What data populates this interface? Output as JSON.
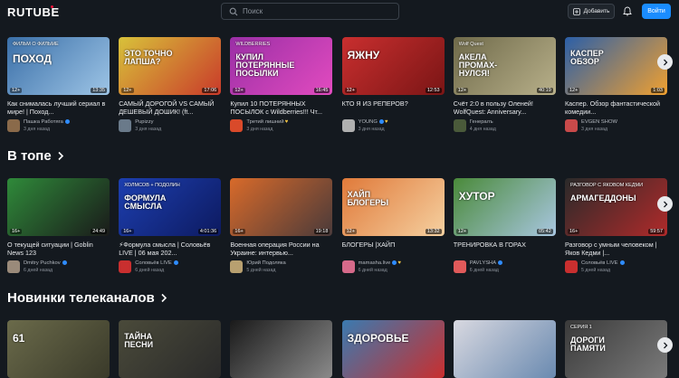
{
  "header": {
    "logo": "RUTUBE",
    "search_placeholder": "Поиск",
    "add_label": "Добавить",
    "login_label": "Войти",
    "accent": "#1a8cff"
  },
  "rows": [
    {
      "title": "",
      "cards": [
        {
          "thumb_text": "ПОХОД",
          "thumb_sub": "ФИЛЬМ О ФИЛЬМЕ",
          "age": "12+",
          "duration": "13:35",
          "title": "Как снималась лучший сериал в мире! | Поход...",
          "channel": "Пашка Работяга",
          "verified": true,
          "heart": false,
          "date": "3 дня назад",
          "bg": "#3a6fa8",
          "bg2": "#9ec5e6",
          "avatar": "#8a6a4a"
        },
        {
          "thumb_text": "ЭТО ТОЧНО\nЛАПША?",
          "thumb_sub": "",
          "age": "12+",
          "duration": "17:06",
          "title": "САМЫЙ ДОРОГОЙ VS САМЫЙ ДЕШЕВЫЙ ДОШИК! (ft...",
          "channel": "Pupizzy",
          "verified": false,
          "heart": false,
          "date": "3 дня назад",
          "bg": "#d8c23a",
          "bg2": "#c93a2a",
          "avatar": "#6a7a8a"
        },
        {
          "thumb_text": "КУПИЛ\nПОТЕРЯННЫЕ\nПОСЫЛКИ",
          "thumb_sub": "WILDBERRIES",
          "age": "12+",
          "duration": "16:45",
          "title": "Купил 10 ПОТЕРЯННЫХ ПОСЫЛОК с Wildberries!!! Чт...",
          "channel": "Третий лишний",
          "verified": false,
          "heart": true,
          "date": "3 дня назад",
          "bg": "#9a2fa6",
          "bg2": "#e24bbf",
          "avatar": "#d94a2a"
        },
        {
          "thumb_text": "ЯЖНУ",
          "thumb_sub": "",
          "age": "12+",
          "duration": "12:53",
          "title": "КТО Я ИЗ РЕПЕРОВ?",
          "channel": "YOUNG",
          "verified": true,
          "heart": true,
          "date": "3 дня назад",
          "bg": "#c92f2f",
          "bg2": "#7a1515",
          "avatar": "#b0b0b0"
        },
        {
          "thumb_text": "АКЕЛА\nПРОМАХ-\nНУЛСЯ!",
          "thumb_sub": "Wolf Quest",
          "age": "12+",
          "duration": "40:19",
          "title": "Счёт 2:0 в пользу Оленей! WolfQuest: Anniversary...",
          "channel": "Генералъ",
          "verified": false,
          "heart": false,
          "date": "4 дня назад",
          "bg": "#6f6a4a",
          "bg2": "#b8b08a",
          "avatar": "#4a5a3a"
        },
        {
          "thumb_text": "КАСПЕР\nОБЗОР",
          "thumb_sub": "",
          "age": "12+",
          "duration": "1:03",
          "title": "Каспер. Обзор фантастической комедии...",
          "channel": "EVGEN SHOW",
          "verified": false,
          "heart": false,
          "date": "3 дня назад",
          "bg": "#2b5fa8",
          "bg2": "#f0a030",
          "avatar": "#c94a4a"
        }
      ]
    },
    {
      "title": "В топе",
      "cards": [
        {
          "thumb_text": "",
          "thumb_sub": "",
          "age": "16+",
          "duration": "24:49",
          "title": "О текущей ситуации | Goblin News 123",
          "channel": "Dmitry Puchkov",
          "verified": true,
          "heart": false,
          "date": "6 дней назад",
          "bg": "#2f8a3a",
          "bg2": "#1a1a1a",
          "avatar": "#9a8a7a"
        },
        {
          "thumb_text": "ФОРМУЛА\nСМЫСЛА",
          "thumb_sub": "ХОЛМСОВ + ПОДОЛИН",
          "age": "16+",
          "duration": "4:01:36",
          "title": "⚡Формула смысла | Соловьёв LIVE | 06 мая 202...",
          "channel": "Соловьёв LIVE",
          "verified": true,
          "heart": false,
          "date": "6 дней назад",
          "bg": "#1d3fb0",
          "bg2": "#0d1a60",
          "avatar": "#c92f2f"
        },
        {
          "thumb_text": "",
          "thumb_sub": "",
          "age": "16+",
          "duration": "19:18",
          "title": "Военная операция России на Украине: интервью...",
          "channel": "Юрий Подоляка",
          "verified": false,
          "heart": false,
          "date": "5 дней назад",
          "bg": "#d86a2a",
          "bg2": "#4a3a3a",
          "avatar": "#b8a070"
        },
        {
          "thumb_text": "ХАЙП\nБЛОГЕРЫ",
          "thumb_sub": "",
          "age": "12+",
          "duration": "13:32",
          "title": "БЛОГЕРЫ |ХАЙП",
          "channel": "mamasha.live",
          "verified": true,
          "heart": true,
          "date": "6 дней назад",
          "bg": "#e07a3a",
          "bg2": "#f5d0a0",
          "avatar": "#d66a8a"
        },
        {
          "thumb_text": "ХУТОР",
          "thumb_sub": "",
          "age": "12+",
          "duration": "05:42",
          "title": "ТРЕНИРОВКА В ГОРАХ",
          "channel": "PAVLYSHA",
          "verified": true,
          "heart": false,
          "date": "6 дней назад",
          "bg": "#4a8a3a",
          "bg2": "#a8c6e0",
          "avatar": "#e05a5a"
        },
        {
          "thumb_text": "АРМАГЕДДОНЫ",
          "thumb_sub": "РАЗГОВОР С ЯКОВОМ КЕДМИ",
          "age": "16+",
          "duration": "59:57",
          "title": "Разговор с умным человеком | Яков Кедми |...",
          "channel": "Соловьёв LIVE",
          "verified": true,
          "heart": false,
          "date": "5 дней назад",
          "bg": "#2a2a2a",
          "bg2": "#b02a2a",
          "avatar": "#c92f2f"
        }
      ]
    },
    {
      "title": "Новинки телеканалов",
      "cards": [
        {
          "thumb_text": "61",
          "thumb_sub": "",
          "bg": "#6a6a4a",
          "bg2": "#3a3a2a"
        },
        {
          "thumb_text": "ТАЙНА\nПЕСНИ",
          "thumb_sub": "",
          "bg": "#4a4a3a",
          "bg2": "#2a2a2a"
        },
        {
          "thumb_text": "",
          "thumb_sub": "",
          "bg": "#1a1a1a",
          "bg2": "#8a8a8a"
        },
        {
          "thumb_text": "ЗДОРОВЬЕ",
          "thumb_sub": "",
          "bg": "#3a7ab0",
          "bg2": "#c92f2f"
        },
        {
          "thumb_text": "",
          "thumb_sub": "",
          "bg": "#d8d8e0",
          "bg2": "#6a8ab0"
        },
        {
          "thumb_text": "ДОРОГИ\nПАМЯТИ",
          "thumb_sub": "СЕРИЯ 1",
          "bg": "#3a3a3a",
          "bg2": "#7a7a7a"
        }
      ]
    }
  ]
}
